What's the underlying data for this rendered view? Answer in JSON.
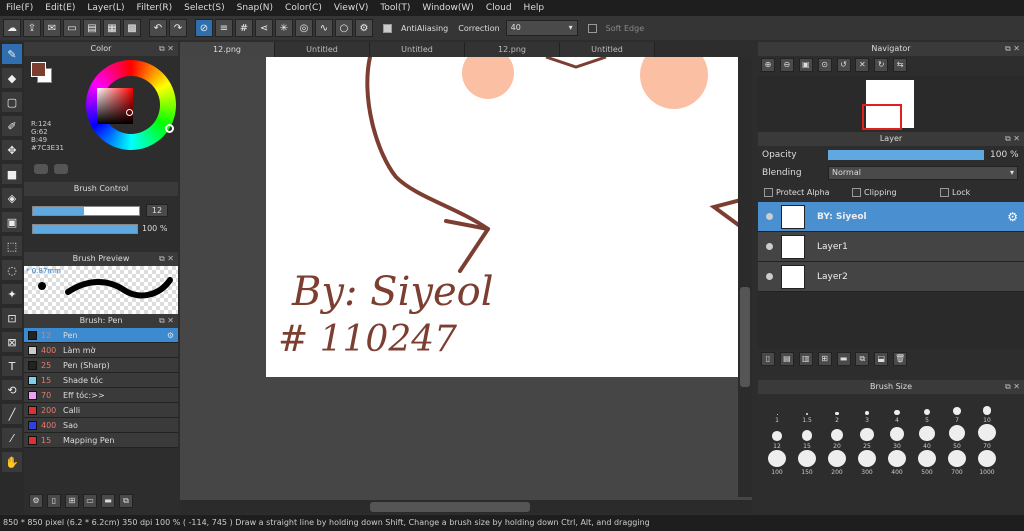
{
  "menu": [
    "File(F)",
    "Edit(E)",
    "Layer(L)",
    "Filter(R)",
    "Select(S)",
    "Snap(N)",
    "Color(C)",
    "View(V)",
    "Tool(T)",
    "Window(W)",
    "Cloud",
    "Help"
  ],
  "toolbar": {
    "antialiasing": "AntiAliasing",
    "correction_label": "Correction",
    "correction_value": "40",
    "soft_edge": "Soft Edge"
  },
  "color_panel": {
    "title": "Color",
    "r": "R:124",
    "g": "G:62",
    "b": "B:49",
    "hex": "#7C3E31",
    "current": "#7c3e31"
  },
  "brush_control": {
    "title": "Brush Control",
    "size": "12",
    "opacity": "100 %",
    "size_fraction": 0.48,
    "opacity_fraction": 1.0
  },
  "brush_preview": {
    "title": "Brush Preview",
    "size_label": "* 0.87mm"
  },
  "brush_list": {
    "title": "Brush: Pen",
    "items": [
      {
        "size": "12",
        "name": "Pen",
        "color": "#222222",
        "selected": true
      },
      {
        "size": "400",
        "name": "Làm mờ",
        "color": "#cccccc"
      },
      {
        "size": "25",
        "name": "Pen (Sharp)",
        "color": "#222222"
      },
      {
        "size": "15",
        "name": "Shade tóc",
        "color": "#7fd0f0"
      },
      {
        "size": "70",
        "name": "Eff tóc:>>",
        "color": "#f0a0f0"
      },
      {
        "size": "200",
        "name": "Calli",
        "color": "#e03030"
      },
      {
        "size": "400",
        "name": "Sao",
        "color": "#3040e0"
      },
      {
        "size": "15",
        "name": "Mapping Pen",
        "color": "#e03030"
      }
    ]
  },
  "tabs": [
    "12.png",
    "Untitled",
    "Untitled",
    "12.png",
    "Untitled"
  ],
  "canvas": {
    "text_line1": "By: Siyeol",
    "text_line2": "# 110247",
    "ink": "#7c3e31"
  },
  "navigator": {
    "title": "Navigator"
  },
  "layer_panel": {
    "title": "Layer",
    "opacity_label": "Opacity",
    "opacity_value": "100 %",
    "opacity_fraction": 1.0,
    "blending_label": "Blending",
    "blending_value": "Normal",
    "protect_alpha": "Protect Alpha",
    "clipping": "Clipping",
    "lock": "Lock",
    "layers": [
      {
        "name": "BY: Siyeol",
        "selected": true
      },
      {
        "name": "Layer1"
      },
      {
        "name": "Layer2"
      }
    ]
  },
  "brush_size": {
    "title": "Brush Size",
    "sizes": [
      "1",
      "1.5",
      "2",
      "3",
      "4",
      "5",
      "7",
      "10",
      "12",
      "15",
      "20",
      "25",
      "30",
      "40",
      "50",
      "70",
      "100",
      "150",
      "200",
      "300",
      "400",
      "500",
      "700",
      "1000"
    ]
  },
  "status": {
    "text": "850 * 850 pixel   (6.2 * 6.2cm)   350 dpi   100 %   ( -114, 745 )   Draw a straight line by holding down Shift, Change a brush size by holding down Ctrl, Alt, and dragging"
  }
}
